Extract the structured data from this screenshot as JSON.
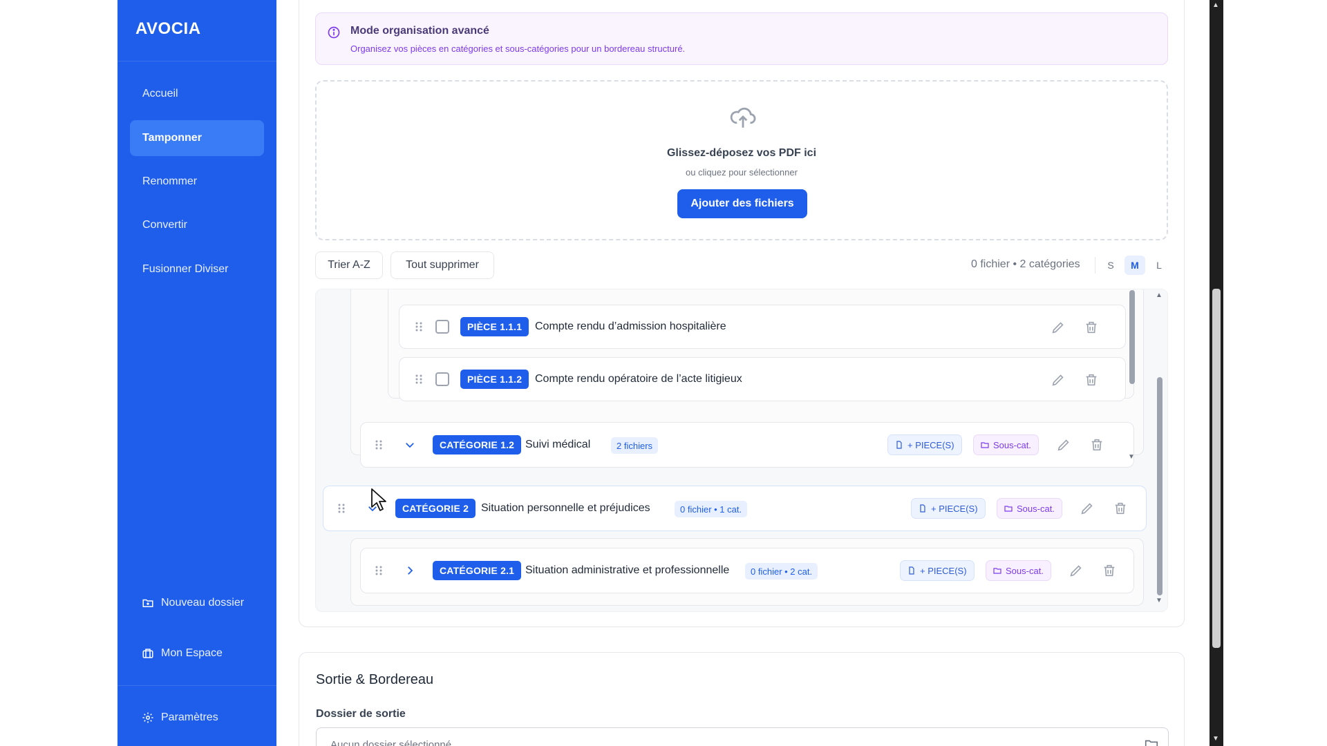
{
  "app": {
    "brand": "AVOCIA"
  },
  "sidebar": {
    "items": [
      {
        "label": "Accueil",
        "active": false
      },
      {
        "label": "Tamponner",
        "active": true
      },
      {
        "label": "Renommer",
        "active": false
      },
      {
        "label": "Convertir",
        "active": false
      },
      {
        "label": "Fusionner Diviser",
        "active": false
      }
    ],
    "bottom": [
      {
        "label": "Nouveau dossier",
        "icon": "folder-plus-icon"
      },
      {
        "label": "Mon Espace",
        "icon": "briefcase-icon"
      },
      {
        "label": "Paramètres",
        "icon": "gear-icon"
      }
    ],
    "bg_color": "#1e5eea"
  },
  "info_banner": {
    "title": "Mode organisation avancé",
    "description": "Organisez vos pièces en catégories et sous-catégories pour un bordereau structuré.",
    "icon": "info-icon"
  },
  "dropzone": {
    "title": "Glissez-déposez vos PDF ici",
    "subtitle": "ou cliquez pour sélectionner",
    "button": "Ajouter des fichiers",
    "icon": "upload-cloud-icon"
  },
  "toolbar": {
    "sort_label": "Trier A-Z",
    "clear_label": "Tout supprimer",
    "summary": "0 fichier • 2 catégories",
    "sizes": [
      "S",
      "M",
      "L"
    ],
    "selected_size": "M"
  },
  "tree": {
    "pieces": [
      {
        "tag": "PIÈCE 1.1.1",
        "title": "Compte rendu d’admission hospitalière"
      },
      {
        "tag": "PIÈCE 1.1.2",
        "title": "Compte rendu opératoire de l’acte litigieux"
      }
    ],
    "categories": [
      {
        "tag": "CATÉGORIE 1.2",
        "title": "Suivi médical",
        "count": "2 fichiers",
        "expanded": true
      },
      {
        "tag": "CATÉGORIE 2",
        "title": "Situation personnelle et préjudices",
        "count": "0 fichier • 1 cat.",
        "expanded": true
      },
      {
        "tag": "CATÉGORIE 2.1",
        "title": "Situation administrative et professionnelle",
        "count": "0 fichier • 2 cat.",
        "expanded": false
      }
    ],
    "add_piece_label": "+ PIECE(S)",
    "subcat_label": "Sous-cat."
  },
  "output": {
    "title": "Sortie & Bordereau",
    "folder_label": "Dossier de sortie",
    "folder_placeholder": "Aucun dossier sélectionné"
  }
}
